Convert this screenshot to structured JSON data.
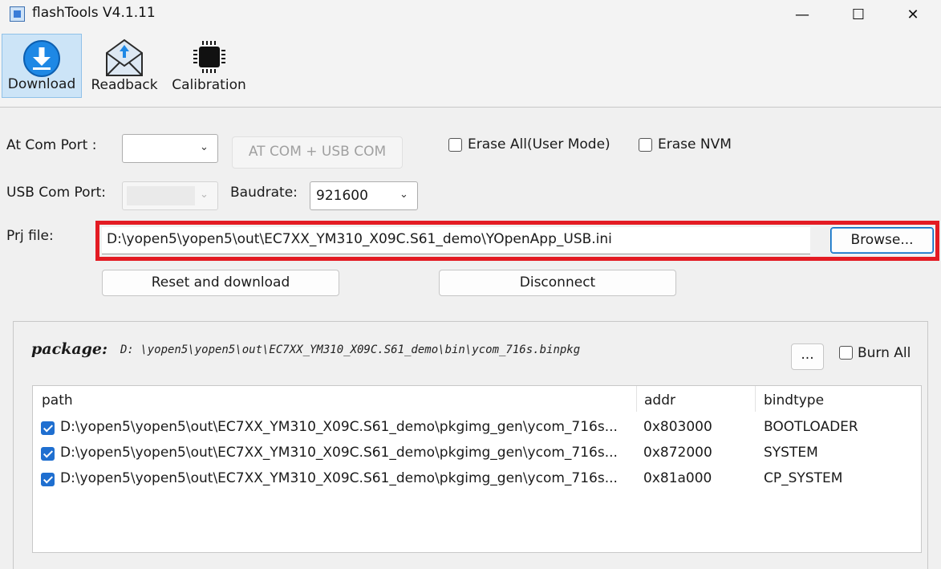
{
  "window": {
    "title": "flashTools V4.1.11",
    "minimize": "—",
    "maximize": "☐",
    "close": "✕"
  },
  "toolbar": [
    {
      "label": "Download",
      "icon": "download-icon",
      "active": true
    },
    {
      "label": "Readback",
      "icon": "readback-icon",
      "active": false
    },
    {
      "label": "Calibration",
      "icon": "chip-icon",
      "active": false
    }
  ],
  "form": {
    "at_com_label": "At Com Port   :",
    "at_com_value": "",
    "at_usb_button": "AT COM + USB COM",
    "erase_all_label": "Erase All(User Mode)",
    "erase_all_checked": false,
    "erase_nvm_label": "Erase NVM",
    "erase_nvm_checked": false,
    "usb_com_label": "USB Com Port:",
    "baudrate_label": "Baudrate:",
    "baudrate_value": "921600",
    "prj_label": "Prj file:",
    "prj_value": "D:\\yopen5\\yopen5\\out\\EC7XX_YM310_X09C.S61_demo\\YOpenApp_USB.ini",
    "browse_button": "Browse...",
    "reset_button": "Reset and download",
    "disconnect_button": "Disconnect"
  },
  "package": {
    "label": "package:",
    "path": "D: \\yopen5\\yopen5\\out\\EC7XX_YM310_X09C.S61_demo\\bin\\ycom_716s.binpkg",
    "more_button": "...",
    "burn_all_label": "Burn All",
    "burn_all_checked": false
  },
  "table": {
    "headers": {
      "path": "path",
      "addr": "addr",
      "bindtype": "bindtype"
    },
    "rows": [
      {
        "checked": true,
        "path": "D:\\yopen5\\yopen5\\out\\EC7XX_YM310_X09C.S61_demo\\pkgimg_gen\\ycom_716s...",
        "addr": "0x803000",
        "bindtype": "BOOTLOADER"
      },
      {
        "checked": true,
        "path": "D:\\yopen5\\yopen5\\out\\EC7XX_YM310_X09C.S61_demo\\pkgimg_gen\\ycom_716s...",
        "addr": "0x872000",
        "bindtype": "SYSTEM"
      },
      {
        "checked": true,
        "path": "D:\\yopen5\\yopen5\\out\\EC7XX_YM310_X09C.S61_demo\\pkgimg_gen\\ycom_716s...",
        "addr": "0x81a000",
        "bindtype": "CP_SYSTEM"
      }
    ]
  },
  "colors": {
    "accent": "#1f6fd0",
    "highlight": "#e31b23",
    "active_tool": "#cce4f7"
  }
}
